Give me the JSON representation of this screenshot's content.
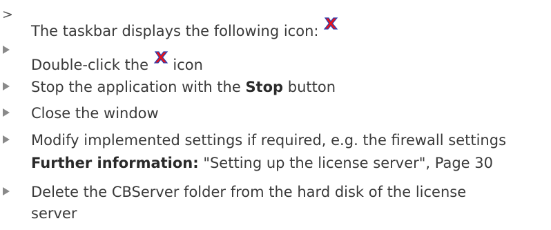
{
  "steps": [
    {
      "marker": ">",
      "text_before": "The taskbar displays the following icon: ",
      "icon": "red-x-icon"
    },
    {
      "marker": "triangle",
      "text_before": "Double-click the ",
      "icon": "red-x-icon",
      "text_after": " icon"
    },
    {
      "marker": "triangle",
      "text_before": "Stop the application with the ",
      "bold": "Stop",
      "text_after": " button"
    },
    {
      "marker": "triangle",
      "text": "Close the window"
    },
    {
      "marker": "triangle",
      "text": "Modify implemented settings if required, e.g. the firewall settings",
      "further_info_label": "Further information:",
      "further_info_text": " \"Setting up the license server\", Page 30"
    },
    {
      "marker": "triangle",
      "text_line1": "Delete the CBServer folder from the hard disk of the license",
      "text_line2": "server"
    }
  ],
  "colors": {
    "text": "#3a3a3a",
    "marker": "#8a8a8a",
    "icon_red": "#e8141b",
    "icon_blue": "#2a3fb0"
  }
}
